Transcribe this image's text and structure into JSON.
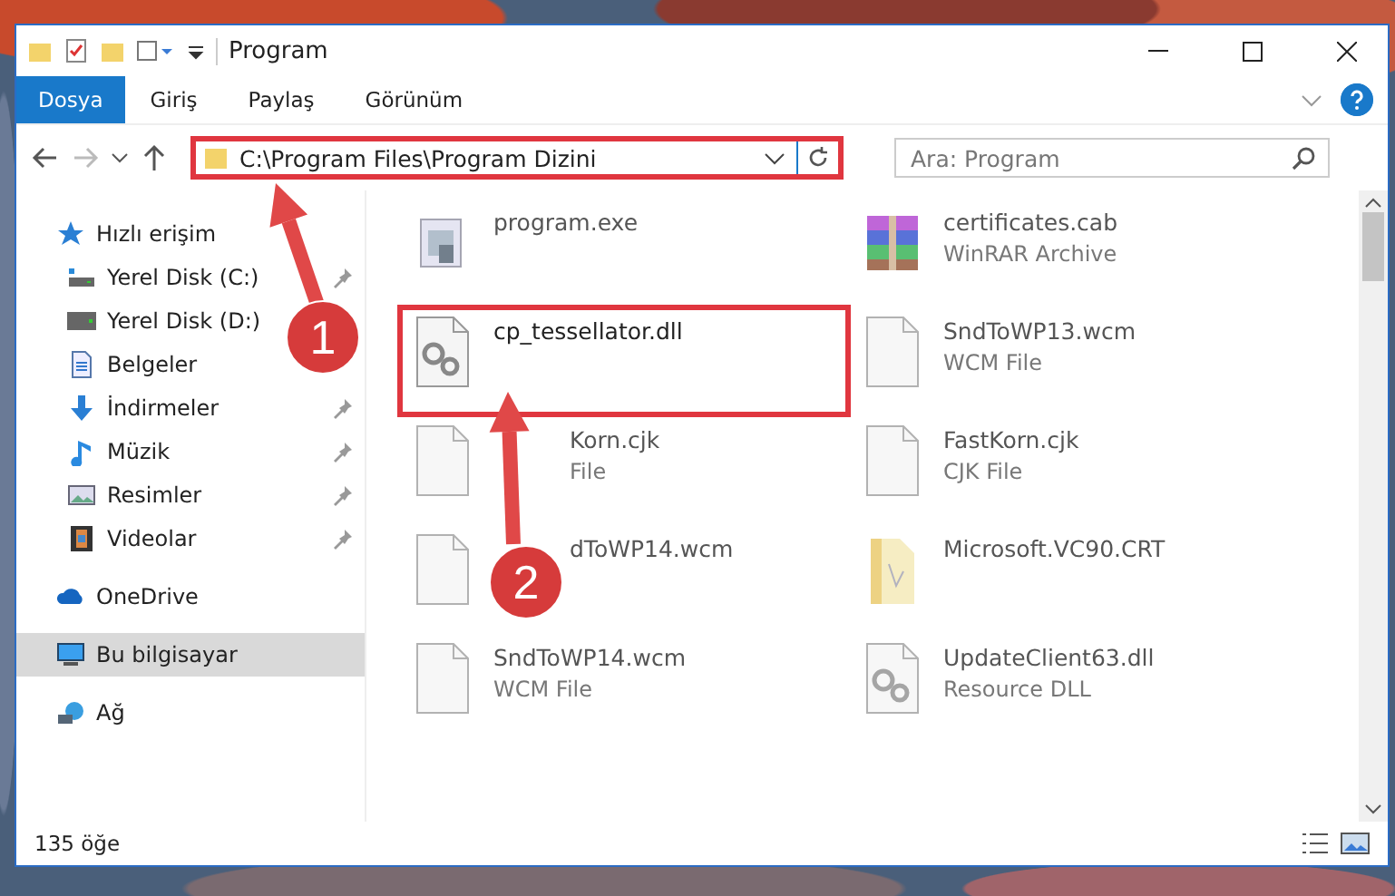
{
  "window": {
    "title": "Program"
  },
  "ribbon_tabs": [
    {
      "label": "Dosya",
      "selected": true
    },
    {
      "label": "Giriş",
      "selected": false
    },
    {
      "label": "Paylaş",
      "selected": false
    },
    {
      "label": "Görünüm",
      "selected": false
    }
  ],
  "address": {
    "path": "C:\\Program Files\\Program Dizini",
    "highlighted": true
  },
  "search": {
    "placeholder": "Ara: Program"
  },
  "sidebar": {
    "items": [
      {
        "label": "Hızlı erişim",
        "kind": "star",
        "pinned": false,
        "selected": false,
        "children": [
          {
            "label": "Yerel Disk (C:)",
            "kind": "diskc",
            "pinned": true,
            "selected": false
          },
          {
            "label": "Yerel Disk (D:)",
            "kind": "disk",
            "pinned": false,
            "selected": false
          },
          {
            "label": "Belgeler",
            "kind": "doc",
            "pinned": false,
            "selected": false
          },
          {
            "label": "İndirmeler",
            "kind": "download",
            "pinned": true,
            "selected": false
          },
          {
            "label": "Müzik",
            "kind": "music",
            "pinned": true,
            "selected": false
          },
          {
            "label": "Resimler",
            "kind": "pictures",
            "pinned": true,
            "selected": false
          },
          {
            "label": "Videolar",
            "kind": "video",
            "pinned": true,
            "selected": false
          }
        ]
      },
      {
        "label": "OneDrive",
        "kind": "cloud",
        "pinned": false,
        "selected": false
      },
      {
        "label": "Bu bilgisayar",
        "kind": "pc",
        "pinned": false,
        "selected": true
      },
      {
        "label": "Ağ",
        "kind": "network",
        "pinned": false,
        "selected": false
      }
    ]
  },
  "files": [
    {
      "name": "program.exe",
      "kind": "exe",
      "blurred": true,
      "highlighted": false,
      "partly_hidden": false
    },
    {
      "name": "certificates.cab",
      "type": "WinRAR Archive",
      "kind": "archive",
      "blurred": true,
      "highlighted": false,
      "partly_hidden": false
    },
    {
      "name": "cp_tessellator.dll",
      "kind": "dll",
      "blurred": false,
      "highlighted": true,
      "partly_hidden": false
    },
    {
      "name": "SndToWP13.wcm",
      "type": "WCM File",
      "kind": "blank",
      "blurred": true,
      "highlighted": false,
      "partly_hidden": false
    },
    {
      "name": "Korn.cjk",
      "type": "File",
      "kind": "blank",
      "blurred": true,
      "highlighted": false,
      "partly_hidden": true
    },
    {
      "name": "FastKorn.cjk",
      "type": "CJK File",
      "kind": "blank",
      "blurred": true,
      "highlighted": false,
      "partly_hidden": false
    },
    {
      "name": "dToWP14.wcm",
      "kind": "blank",
      "blurred": true,
      "highlighted": false,
      "partly_hidden": true
    },
    {
      "name": "Microsoft.VC90.CRT",
      "kind": "folder",
      "blurred": true,
      "highlighted": false,
      "partly_hidden": false
    },
    {
      "name": "SndToWP14.wcm",
      "type": "WCM File",
      "kind": "blank",
      "blurred": true,
      "highlighted": false,
      "partly_hidden": false
    },
    {
      "name": "UpdateClient63.dll",
      "type": "Resource DLL",
      "kind": "dll",
      "blurred": true,
      "highlighted": false,
      "partly_hidden": false
    }
  ],
  "status_bar": {
    "count": "135 öğe"
  },
  "annotations": [
    {
      "number": "1"
    },
    {
      "number": "2"
    }
  ]
}
